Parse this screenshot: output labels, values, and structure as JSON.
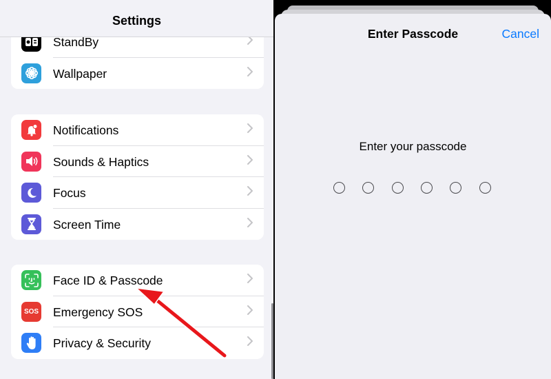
{
  "settings": {
    "title": "Settings",
    "groups": [
      [
        {
          "label": "StandBy",
          "icon": "standby-icon",
          "color": "#000000"
        },
        {
          "label": "Wallpaper",
          "icon": "flower-icon",
          "color": "#2ea0dc"
        }
      ],
      [
        {
          "label": "Notifications",
          "icon": "bell-icon",
          "color": "#f23a3c"
        },
        {
          "label": "Sounds & Haptics",
          "icon": "speaker-icon",
          "color": "#f0355a"
        },
        {
          "label": "Focus",
          "icon": "moon-icon",
          "color": "#5d5ad8"
        },
        {
          "label": "Screen Time",
          "icon": "hourglass-icon",
          "color": "#5d5ad8"
        }
      ],
      [
        {
          "label": "Face ID & Passcode",
          "icon": "face-id-icon",
          "color": "#36c05a"
        },
        {
          "label": "Emergency SOS",
          "icon": "sos-icon",
          "color": "#e63a32",
          "icon_text": "SOS"
        },
        {
          "label": "Privacy & Security",
          "icon": "hand-icon",
          "color": "#2f7ef6"
        }
      ]
    ]
  },
  "passcode": {
    "title": "Enter Passcode",
    "cancel_label": "Cancel",
    "prompt": "Enter your passcode",
    "digits": 6,
    "accent_color": "#0a7aff"
  },
  "annotation": {
    "color": "#e8171b",
    "target": "Face ID & Passcode"
  }
}
